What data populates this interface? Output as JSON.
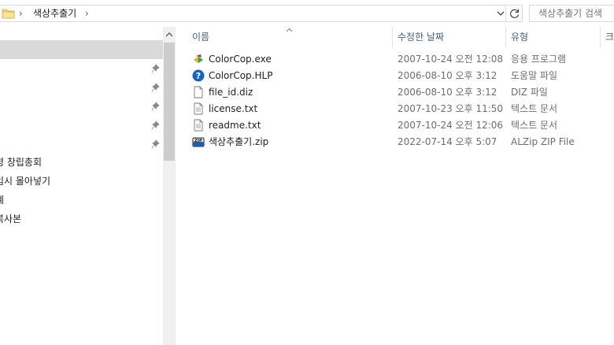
{
  "address": {
    "breadcrumb": "색상추출기",
    "chevron": "›",
    "dropdown_icon": "chevron-down-icon",
    "refresh_icon": "refresh-icon"
  },
  "search": {
    "placeholder": "색상추출기 검색"
  },
  "nav": {
    "items": [
      {
        "label": "",
        "selected": true,
        "pinned": false
      },
      {
        "label": "",
        "pinned": true
      },
      {
        "label": "",
        "pinned": true
      },
      {
        "label": "",
        "pinned": true
      },
      {
        "label": "",
        "pinned": true
      },
      {
        "label": "",
        "pinned": true
      },
      {
        "label": "령 창립총회",
        "pinned": false
      },
      {
        "label": "임시 몰아넣기",
        "pinned": false
      },
      {
        "label": "계",
        "pinned": false
      },
      {
        "label": "복사본",
        "pinned": false
      }
    ]
  },
  "columns": {
    "name": "이름",
    "modified": "수정한 날짜",
    "type": "유형",
    "size": "크"
  },
  "files": [
    {
      "name": "ColorCop.exe",
      "modified": "2007-10-24 오전 12:08",
      "type": "응용 프로그램",
      "icon": "colorcop-exe-icon"
    },
    {
      "name": "ColorCop.HLP",
      "modified": "2006-08-10 오후 3:12",
      "type": "도움말 파일",
      "icon": "help-file-icon"
    },
    {
      "name": "file_id.diz",
      "modified": "2006-08-10 오후 3:12",
      "type": "DIZ 파일",
      "icon": "blank-file-icon"
    },
    {
      "name": "license.txt",
      "modified": "2007-10-23 오후 11:50",
      "type": "텍스트 문서",
      "icon": "text-file-icon"
    },
    {
      "name": "readme.txt",
      "modified": "2007-10-24 오전 12:06",
      "type": "텍스트 문서",
      "icon": "text-file-icon"
    },
    {
      "name": "색상추출기.zip",
      "modified": "2022-07-14 오후 5:07",
      "type": "ALZip ZIP File",
      "icon": "zip-file-icon"
    }
  ],
  "colors": {
    "header_text": "#4c607a",
    "selected_nav": "#d9d9d9",
    "help_blue": "#1565c0",
    "folder_yellow": "#f8d775"
  }
}
